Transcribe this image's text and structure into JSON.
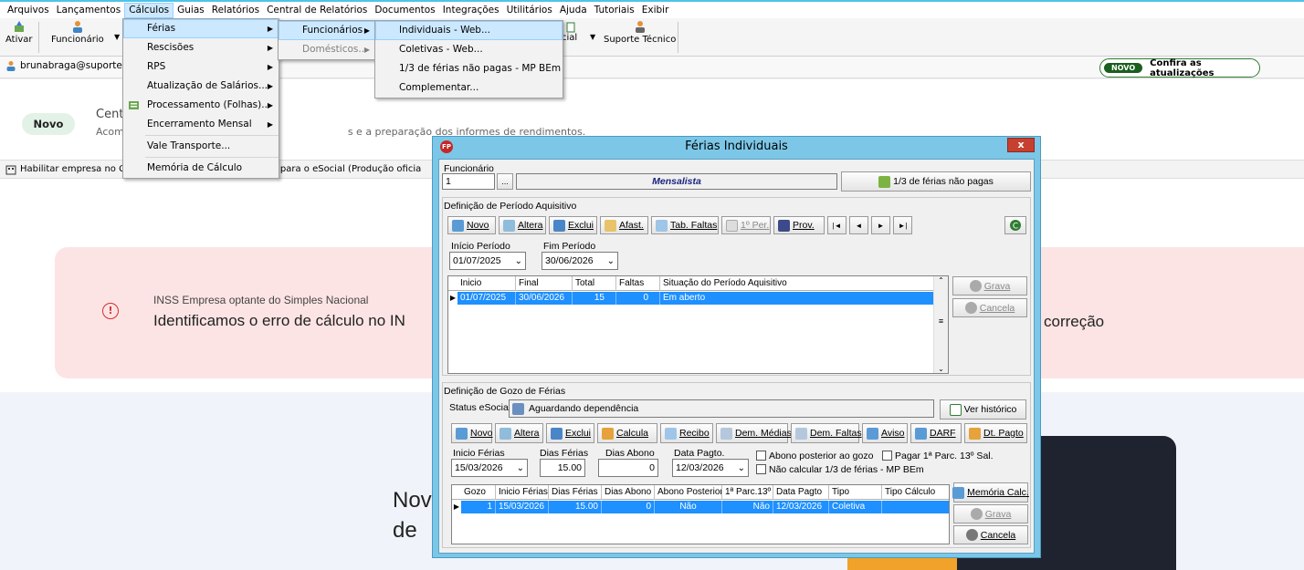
{
  "menubar": [
    "Arquivos",
    "Lançamentos",
    "Cálculos",
    "Guias",
    "Relatórios",
    "Central de Relatórios",
    "Documentos",
    "Integrações",
    "Utilitários",
    "Ajuda",
    "Tutoriais",
    "Exibir"
  ],
  "toolbar": {
    "ativar": "Ativar",
    "funcionario": "Funcionário",
    "cial": "cial",
    "suporte": "Suporte Técnico"
  },
  "user": "brunabraga@suporte",
  "updates": {
    "pill": "NOVO",
    "label": "Confira as atualizações"
  },
  "central": {
    "chip": "Novo",
    "title": "Cent",
    "desc_start": "Acom",
    "desc_end": "s e a preparação dos informes de rendimentos."
  },
  "esocial_bar": {
    "start": "Habilitar empresa no C",
    "end": "ada para o eSocial (Produção oficia"
  },
  "alert": {
    "subtitle": "INSS Empresa optante do Simples Nacional",
    "title": "Identificamos o erro de cálculo no IN",
    "title_end": "correção"
  },
  "promo": {
    "line1": "Nov",
    "line2": "de"
  },
  "menu_calculos": {
    "items": [
      "Férias",
      "Rescisões",
      "RPS",
      "Atualização de Salários...",
      "Processamento (Folhas)...",
      "Encerramento Mensal",
      "Vale Transporte...",
      "Memória de Cálculo"
    ]
  },
  "menu_ferias": {
    "items": [
      "Funcionários",
      "Domésticos..."
    ]
  },
  "menu_funcionarios": {
    "items": [
      "Individuais - Web...",
      "Coletivas - Web...",
      "1/3 de férias não pagas - MP BEm",
      "Complementar..."
    ]
  },
  "dialog": {
    "title": "Férias Individuais",
    "close": "x",
    "logo": "FP",
    "funcionario_label": "Funcionário",
    "funcionario_value": "1",
    "lookup": "...",
    "categoria": "Mensalista",
    "um_terco_btn": "1/3 de férias não pagas",
    "aquisitivo": {
      "section": "Definição de Período Aquisitivo",
      "buttons": [
        "Novo",
        "Altera",
        "Exclui",
        "Afast.",
        "Tab. Faltas",
        "1º Per.",
        "Prov."
      ],
      "nav": [
        "|◄",
        "◄",
        "►",
        "►|"
      ],
      "inicio_label": "Início Período",
      "inicio_value": "01/07/2025",
      "fim_label": "Fim Período",
      "fim_value": "30/06/2026",
      "columns": [
        "Inicio",
        "Final",
        "Total",
        "Faltas",
        "Situação do Período Aquisitivo"
      ],
      "rows": [
        [
          "01/07/2025",
          "30/06/2026",
          "15",
          "0",
          "Em aberto"
        ]
      ],
      "grava": "Grava",
      "cancela": "Cancela"
    },
    "gozo": {
      "section": "Definição de Gozo de Férias",
      "status_label": "Status eSocial:",
      "status_value": "Aguardando dependência",
      "historico": "Ver histórico",
      "buttons": [
        "Novo",
        "Altera",
        "Exclui",
        "Calcula",
        "Recibo",
        "Dem. Médias",
        "Dem. Faltas",
        "Aviso",
        "DARF",
        "Dt. Pagto"
      ],
      "inicio_label": "Inicio Férias",
      "inicio_value": "15/03/2026",
      "dias_label": "Dias Férias",
      "dias_value": "15.00",
      "abono_label": "Dias Abono",
      "abono_value": "0",
      "pagto_label": "Data Pagto.",
      "pagto_value": "12/03/2026",
      "chk_abono": "Abono posterior ao gozo",
      "chk_pagar": "Pagar 1ª Parc. 13º Sal.",
      "chk_nao_calc": "Não calcular 1/3 de férias - MP BEm",
      "columns": [
        "Gozo",
        "Inicio Férias",
        "Dias Férias",
        "Dias Abono",
        "Abono Posterior",
        "1ª Parc.13º",
        "Data Pagto",
        "Tipo",
        "Tipo Cálculo"
      ],
      "rows": [
        [
          "1",
          "15/03/2026",
          "15.00",
          "0",
          "Não",
          "Não",
          "12/03/2026",
          "Coletiva",
          ""
        ]
      ],
      "memoria": "Memória Calc.",
      "grava": "Grava",
      "cancela": "Cancela"
    }
  },
  "colors": {
    "accent": "#4fc3e8",
    "selection": "#1e90ff",
    "alert_bg": "#fde4e4",
    "dialog_frame": "#7cc7e8"
  }
}
